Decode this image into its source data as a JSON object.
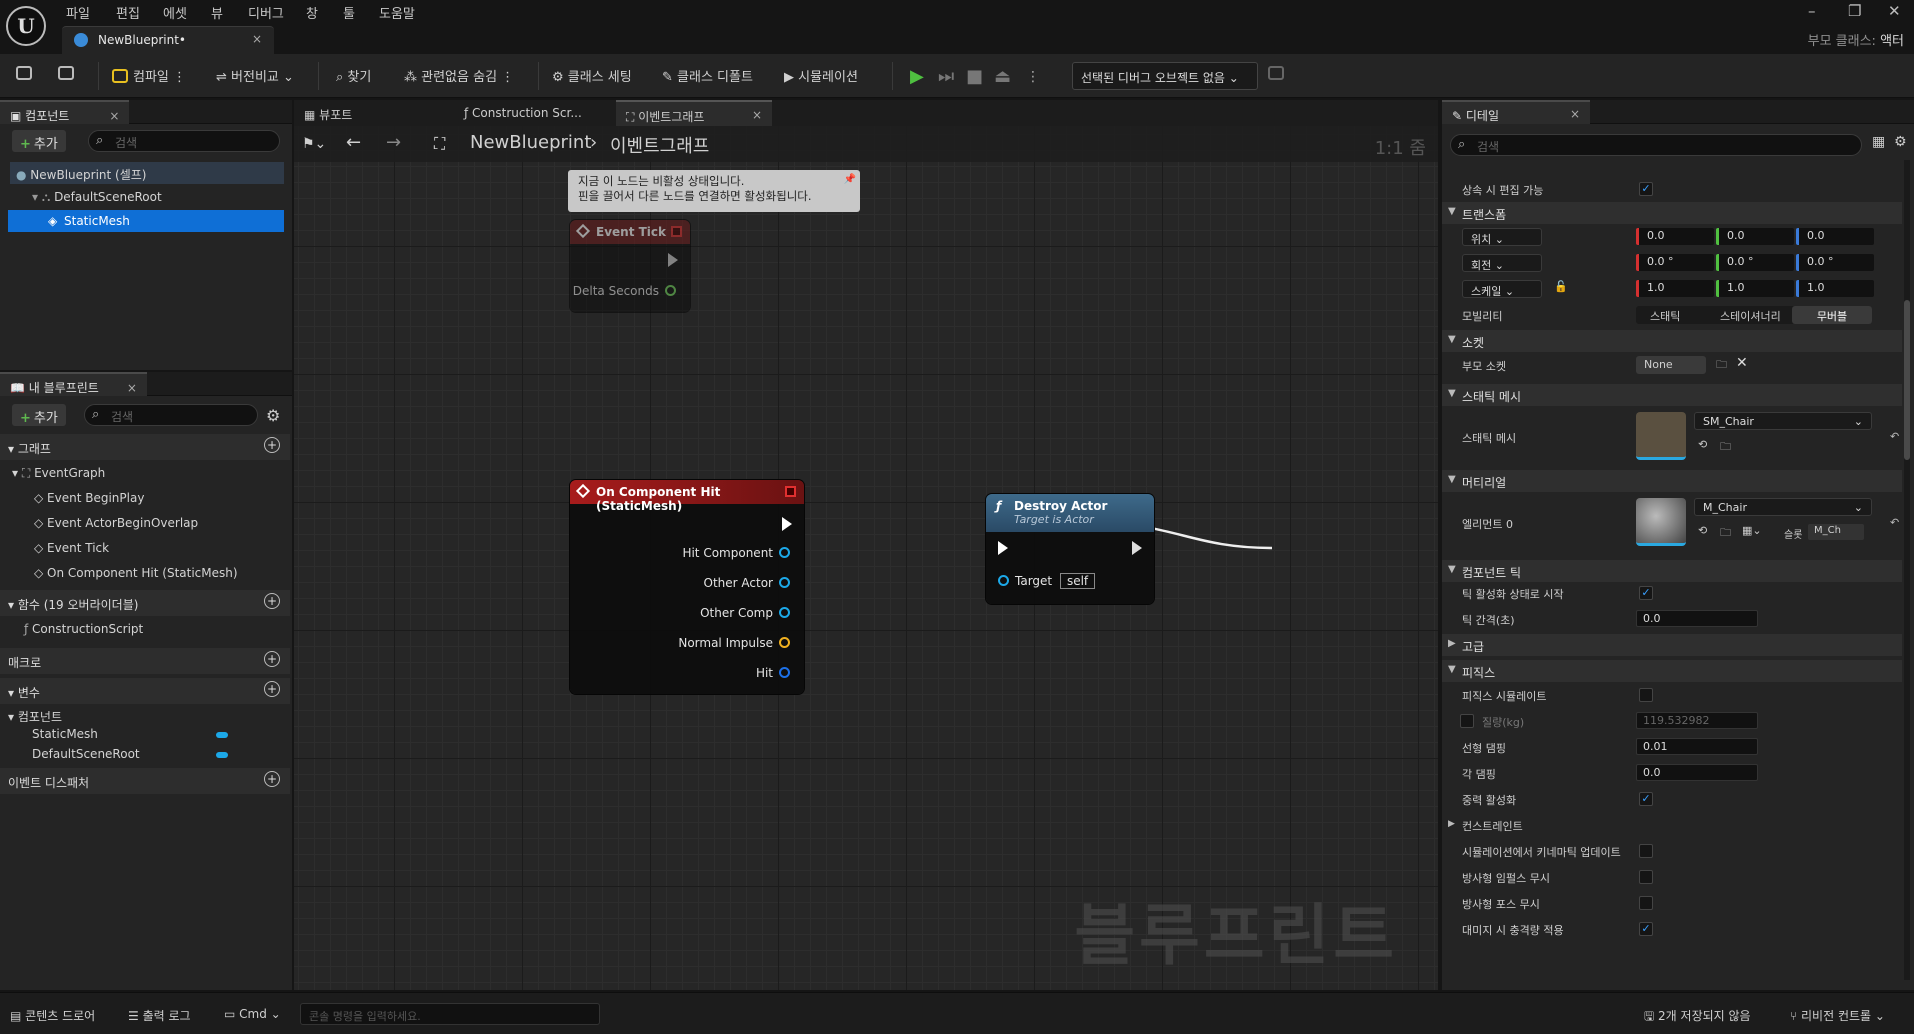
{
  "menu": [
    "파일",
    "편집",
    "에셋",
    "뷰",
    "디버그",
    "창",
    "툴",
    "도움말"
  ],
  "app": {
    "logo": "U",
    "tab_title": "NewBlueprint•",
    "parent_class_label": "부모 클래스:",
    "parent_class_value": "액터"
  },
  "toolbar": {
    "compile": "컴파일",
    "diff": "버전비교",
    "find": "찾기",
    "hide_unrelated": "관련없음 숨김",
    "class_settings": "클래스 세팅",
    "class_defaults": "클래스 디폴트",
    "simulation": "시뮬레이션",
    "debug_object": "선택된 디버그 오브젝트 없음"
  },
  "components": {
    "tab": "컴포넌트",
    "add": "추가",
    "search_placeholder": "검색",
    "tree": [
      "NewBlueprint (셀프)",
      "DefaultSceneRoot",
      "StaticMesh"
    ]
  },
  "my_blueprint": {
    "tab": "내 블루프린트",
    "add": "추가",
    "search_placeholder": "검색",
    "graph_cat": "그래프",
    "event_graph": "EventGraph",
    "events": [
      "Event BeginPlay",
      "Event ActorBeginOverlap",
      "Event Tick",
      "On Component Hit (StaticMesh)"
    ],
    "functions_cat": "함수 (19 오버라이더블)",
    "construction": "ConstructionScript",
    "macros_cat": "매크로",
    "variables_cat": "변수",
    "components_sub": "컴포넌트",
    "vars": [
      "StaticMesh",
      "DefaultSceneRoot"
    ],
    "dispatchers_cat": "이벤트 디스패처"
  },
  "graph": {
    "tabs": [
      "뷰포트",
      "Construction Scr...",
      "이벤트그래프"
    ],
    "breadcrumb_root": "NewBlueprint",
    "breadcrumb_leaf": "이벤트그래프",
    "zoom": "1:1 줌",
    "watermark": "블루프린트",
    "tooltip_line1": "지금 이 노드는 비활성 상태입니다.",
    "tooltip_line2": "핀을 끌어서 다른 노드를 연결하면 활성화됩니다.",
    "tick_node": {
      "title": "Event Tick",
      "pin": "Delta Seconds"
    },
    "hit_node": {
      "title": "On Component Hit (StaticMesh)",
      "pins": [
        "Hit Component",
        "Other Actor",
        "Other Comp",
        "Normal Impulse",
        "Hit"
      ]
    },
    "destroy_node": {
      "title": "Destroy Actor",
      "subtitle": "Target is Actor",
      "target": "Target",
      "self": "self"
    }
  },
  "details": {
    "tab": "디테일",
    "search_placeholder": "검색",
    "inherit_edit": "상속 시 편집 가능",
    "transform": "트랜스폼",
    "location": "위치",
    "rotation": "회전",
    "scale": "스케일",
    "loc": [
      "0.0",
      "0.0",
      "0.0"
    ],
    "rot": [
      "0.0 °",
      "0.0 °",
      "0.0 °"
    ],
    "scl": [
      "1.0",
      "1.0",
      "1.0"
    ],
    "mobility": "모빌리티",
    "mob_opts": [
      "스태틱",
      "스테이셔너리",
      "무버블"
    ],
    "socket": "소켓",
    "parent_socket": "부모 소켓",
    "socket_value": "None",
    "static_mesh_cat": "스태틱 메시",
    "static_mesh": "스태틱 메시",
    "mesh_value": "SM_Chair",
    "materials": "머티리얼",
    "element0": "엘리먼트 0",
    "material_value": "M_Chair",
    "slot_label": "슬롯",
    "slot_value": "M_Ch",
    "comp_tick": "컴포넌트 틱",
    "tick_start": "틱 활성화 상태로 시작",
    "tick_interval": "틱 간격(초)",
    "tick_interval_val": "0.0",
    "advanced": "고급",
    "physics": "피직스",
    "simulate": "피직스 시뮬레이트",
    "mass": "질량(kg)",
    "mass_val": "119.532982",
    "linear_damp": "선형 댐핑",
    "linear_val": "0.01",
    "angular_damp": "각 댐핑",
    "angular_val": "0.0",
    "gravity": "중력 활성화",
    "constraints": "컨스트레인트",
    "kinematic": "시뮬레이션에서 키네마틱 업데이트",
    "ignore_radial_impulse": "방사형 임펄스 무시",
    "ignore_radial_force": "방사형 포스 무시",
    "apply_impulse": "대미지 시 충격량 적용"
  },
  "status": {
    "content_drawer": "콘텐츠 드로어",
    "output_log": "출력 로그",
    "cmd": "Cmd",
    "console_placeholder": "콘솔 명령을 입력하세요.",
    "unsaved": "2개 저장되지 않음",
    "revision": "리비전 컨트롤"
  }
}
